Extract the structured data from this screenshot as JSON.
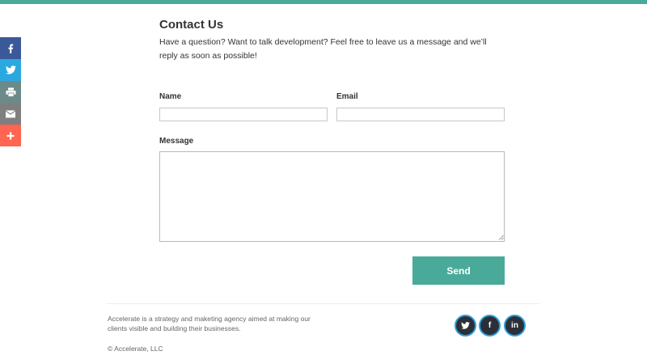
{
  "colors": {
    "accent": "#4aaa99",
    "facebook": "#3b5998",
    "twitter": "#2aa9e0",
    "print": "#6d8a8a",
    "email": "#7f7f7f",
    "more": "#ff6550",
    "social_ring": "#2b9fd9",
    "social_fill": "#2c2f38"
  },
  "share_bar": {
    "items": [
      {
        "icon": "facebook-icon"
      },
      {
        "icon": "twitter-icon"
      },
      {
        "icon": "print-icon"
      },
      {
        "icon": "email-icon"
      },
      {
        "icon": "plus-icon"
      }
    ]
  },
  "contact": {
    "title": "Contact Us",
    "intro": "Have a question? Want to talk development? Feel free to leave us a message and we’ll reply as soon as possible!",
    "name_label": "Name",
    "name_value": "",
    "email_label": "Email",
    "email_value": "",
    "message_label": "Message",
    "message_value": "",
    "send_label": "Send"
  },
  "footer": {
    "description": "Accelerate is a strategy and maketing agency aimed at making our clients visible and building their businesses.",
    "copyright": "© Accelerate, LLC",
    "social": [
      {
        "icon": "twitter-icon"
      },
      {
        "icon": "facebook-icon",
        "glyph": "f"
      },
      {
        "icon": "linkedin-icon",
        "glyph": "in"
      }
    ]
  }
}
